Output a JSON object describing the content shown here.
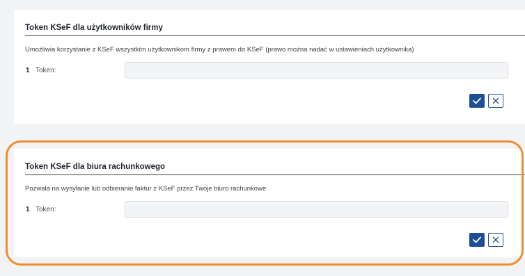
{
  "sections": [
    {
      "title": "Token KSeF dla użytkowników firmy",
      "description": "Umożliwia korzystanie z KSeF wszystkim użytkownikom firmy z prawem do KSeF (prawo można nadać w ustawieniach użytkownika)",
      "row_number": "1",
      "field_label": "Token:",
      "field_value": ""
    },
    {
      "title": "Token KSeF dla biura rachunkowego",
      "description": "Pozwala na wysyłanie lub odbieranie faktur z KSeF przez Twoje biuro rachunkowe",
      "row_number": "1",
      "field_label": "Token:",
      "field_value": ""
    }
  ],
  "colors": {
    "accent": "#1e4f95",
    "highlight": "#f08c2e",
    "background": "#f2f3f5"
  },
  "icons": {
    "confirm": "check-icon",
    "cancel": "close-icon"
  }
}
